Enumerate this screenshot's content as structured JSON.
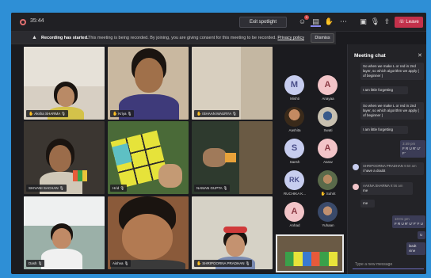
{
  "topbar": {
    "timer": "35:44",
    "spotlight_label": "Exit spotlight",
    "chat_badge": "1",
    "leave_label": "Leave",
    "colors": {
      "leave": "#c4314b",
      "accent": "#8c8cf2"
    }
  },
  "banner": {
    "strong": "Recording has started.",
    "text": "This meeting is being recorded. By joining, you are giving consent for this meeting to be recorded.",
    "link": "Privacy policy",
    "dismiss_label": "Dismiss"
  },
  "tiles": [
    {
      "name": "Aksha SHARMA",
      "hand": true
    },
    {
      "name": "Kriya",
      "hand": true
    },
    {
      "name": "ISHAAN MAURYA",
      "hand": true
    },
    {
      "name": "SHIVANI SACHAN",
      "hand": false
    },
    {
      "name": "Hrid",
      "hand": false
    },
    {
      "name": "NAMAN GUPTA",
      "hand": false
    },
    {
      "name": "Dash",
      "hand": false
    },
    {
      "name": "Aishva",
      "hand": false
    },
    {
      "name": "SHRIPOORNA PRADHAN",
      "hand": true
    }
  ],
  "participants": [
    {
      "initials": "M",
      "name": "Mishti",
      "style": "blue"
    },
    {
      "initials": "A",
      "name": "Anayaa",
      "style": "pink"
    },
    {
      "initials": "",
      "name": "Aashita",
      "style": "photo"
    },
    {
      "initials": "",
      "name": "Swati",
      "style": "photo"
    },
    {
      "initials": "S",
      "name": "Saesh",
      "style": "blue"
    },
    {
      "initials": "A",
      "name": "Aarav",
      "style": "pink"
    },
    {
      "initials": "RK",
      "name": "RUCHIKA K...",
      "style": "blue"
    },
    {
      "initials": "",
      "name": "Suhrit",
      "style": "photo"
    },
    {
      "initials": "A",
      "name": "Anhad",
      "style": "pink"
    },
    {
      "initials": "",
      "name": "Yuhaan",
      "style": "photo"
    }
  ],
  "chat": {
    "title": "Meeting chat",
    "messages": [
      {
        "text": "So when we make L or red in 2nd layer, so which algorithm we apply ( of beginner )"
      },
      {
        "text": "I am little forgetting"
      },
      {
        "text": "So when we make L or red in 2nd layer, so which algorithm we apply ( of beginner )"
      },
      {
        "text": "I am little forgetting"
      },
      {
        "time": "3:49 pm",
        "text": "F R U R' U' F'"
      },
      {
        "sender": "SHRIPOORNA PRADHAN",
        "time": "9:50 am",
        "text": "i have a doubt"
      },
      {
        "sender": "AAKNA SHARMA",
        "time": "9:56 am",
        "text": "me"
      },
      {
        "text": "me"
      },
      {
        "time": "10:01 pm",
        "text": "F R U R' U' F' F U"
      },
      {
        "text": "U"
      },
      {
        "text": "lasdt vine"
      }
    ],
    "placeholder": "Type a new message"
  }
}
